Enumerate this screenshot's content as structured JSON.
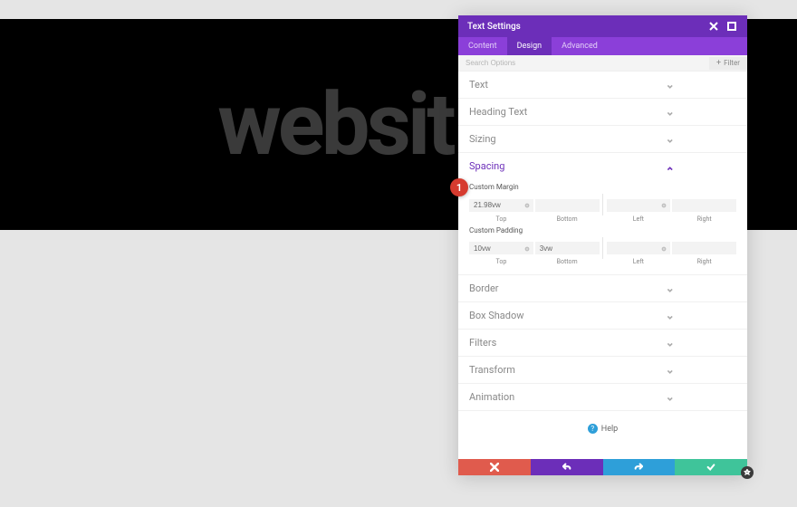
{
  "hero_text": "websit",
  "panel": {
    "title": "Text Settings",
    "tabs": [
      "Content",
      "Design",
      "Advanced"
    ],
    "active_tab": 1,
    "search_ph": "Search Options",
    "filter_label": "Filter",
    "help": "Help",
    "badge": "1"
  },
  "sections": {
    "text": "Text",
    "heading": "Heading Text",
    "sizing": "Sizing",
    "spacing": "Spacing",
    "border": "Border",
    "box_shadow": "Box Shadow",
    "filters": "Filters",
    "transform": "Transform",
    "animation": "Animation"
  },
  "spacing": {
    "margin_label": "Custom Margin",
    "padding_label": "Custom Padding",
    "margin": {
      "top": "21.98vw",
      "bottom": "",
      "left": "",
      "right": ""
    },
    "padding": {
      "top": "10vw",
      "bottom": "3vw",
      "left": "",
      "right": ""
    },
    "side_labels": {
      "top": "Top",
      "bottom": "Bottom",
      "left": "Left",
      "right": "Right"
    }
  }
}
